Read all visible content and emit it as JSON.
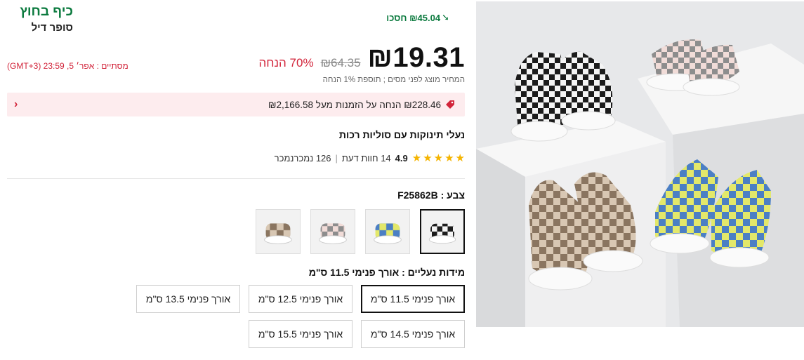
{
  "brand": {
    "top": "כיף בחוץ",
    "bottom": "סופר דיל"
  },
  "savings": {
    "text": "₪45.04 חסכו"
  },
  "price": {
    "current": "₪19.31",
    "original": "₪64.35",
    "discount": "70% הנחה"
  },
  "countdown": {
    "text": "(GMT+3) מסתיים : אפר׳ 5, 23:59"
  },
  "tax_note": "המחיר מוצג לפני מסים ; תוספת 1% הנחה",
  "promo": {
    "text": "₪228.46 הנחה על הזמנות מעל ₪2,166.58"
  },
  "product_title": "נעלי תינוקות עם סוליות רכות",
  "rating": {
    "value": "4.9",
    "reviews": "14 חוות דעת",
    "sold": "126 נמכרנמכר",
    "stars": 5
  },
  "color": {
    "label": "צבע : F25862B",
    "swatches": [
      "black-checker",
      "blue-yellow-checker",
      "pink-checker",
      "khaki-checker"
    ],
    "selected_index": 0
  },
  "sizes": {
    "label": "מידות נעליים : אורך פנימי 11.5 ס\"מ",
    "options": [
      "אורך פנימי 11.5 ס\"מ",
      "אורך פנימי 12.5 ס\"מ",
      "אורך פנימי 13.5 ס\"מ",
      "אורך פנימי 14.5 ס\"מ",
      "אורך פנימי 15.5 ס\"מ"
    ],
    "selected_index": 0
  },
  "colors": {
    "accent_green": "#0b7a3e",
    "sale_red": "#d2243a",
    "star": "#f5b400",
    "promo_bg": "#fdecee"
  }
}
